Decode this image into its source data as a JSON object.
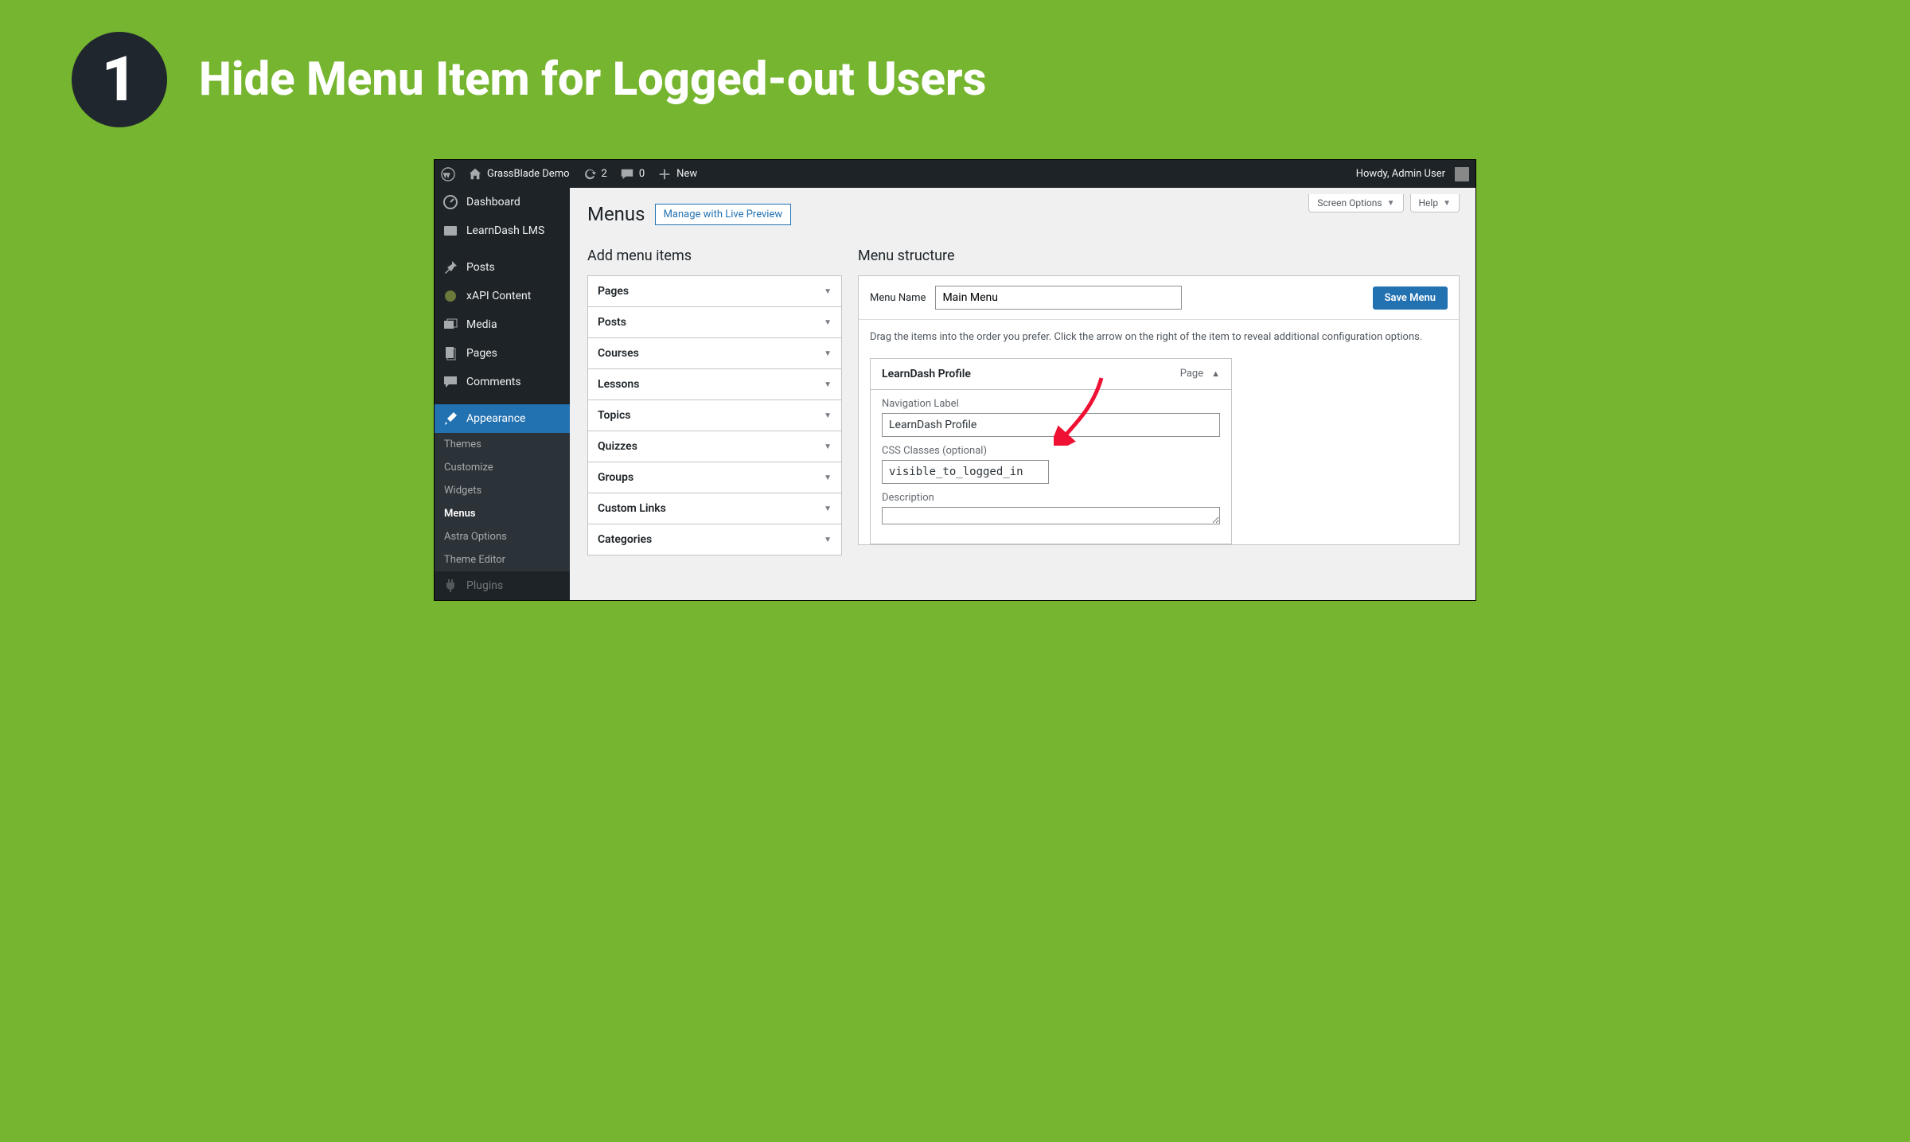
{
  "banner": {
    "number": "1",
    "title": "Hide Menu Item for Logged-out Users"
  },
  "adminbar": {
    "site_name": "GrassBlade Demo",
    "updates_count": "2",
    "comments_count": "0",
    "new_label": "New",
    "howdy": "Howdy, Admin User"
  },
  "sidebar": {
    "dashboard": "Dashboard",
    "learndash": "LearnDash LMS",
    "posts": "Posts",
    "xapi": "xAPI Content",
    "media": "Media",
    "pages": "Pages",
    "comments": "Comments",
    "appearance": "Appearance",
    "sub": {
      "themes": "Themes",
      "customize": "Customize",
      "widgets": "Widgets",
      "menus": "Menus",
      "astra": "Astra Options",
      "editor": "Theme Editor"
    },
    "plugins": "Plugins"
  },
  "toptabs": {
    "screen": "Screen Options",
    "help": "Help"
  },
  "page": {
    "title": "Menus",
    "preview_btn": "Manage with Live Preview",
    "add_items_heading": "Add menu items",
    "structure_heading": "Menu structure",
    "menu_name_label": "Menu Name",
    "menu_name_value": "Main Menu",
    "save_btn": "Save Menu",
    "instructions": "Drag the items into the order you prefer. Click the arrow on the right of the item to reveal additional configuration options."
  },
  "accordions": [
    "Pages",
    "Posts",
    "Courses",
    "Lessons",
    "Topics",
    "Quizzes",
    "Groups",
    "Custom Links",
    "Categories"
  ],
  "menu_item": {
    "title": "LearnDash Profile",
    "type": "Page",
    "nav_label_lbl": "Navigation Label",
    "nav_label_val": "LearnDash Profile",
    "css_lbl": "CSS Classes (optional)",
    "css_val": "visible_to_logged_in",
    "desc_lbl": "Description"
  }
}
